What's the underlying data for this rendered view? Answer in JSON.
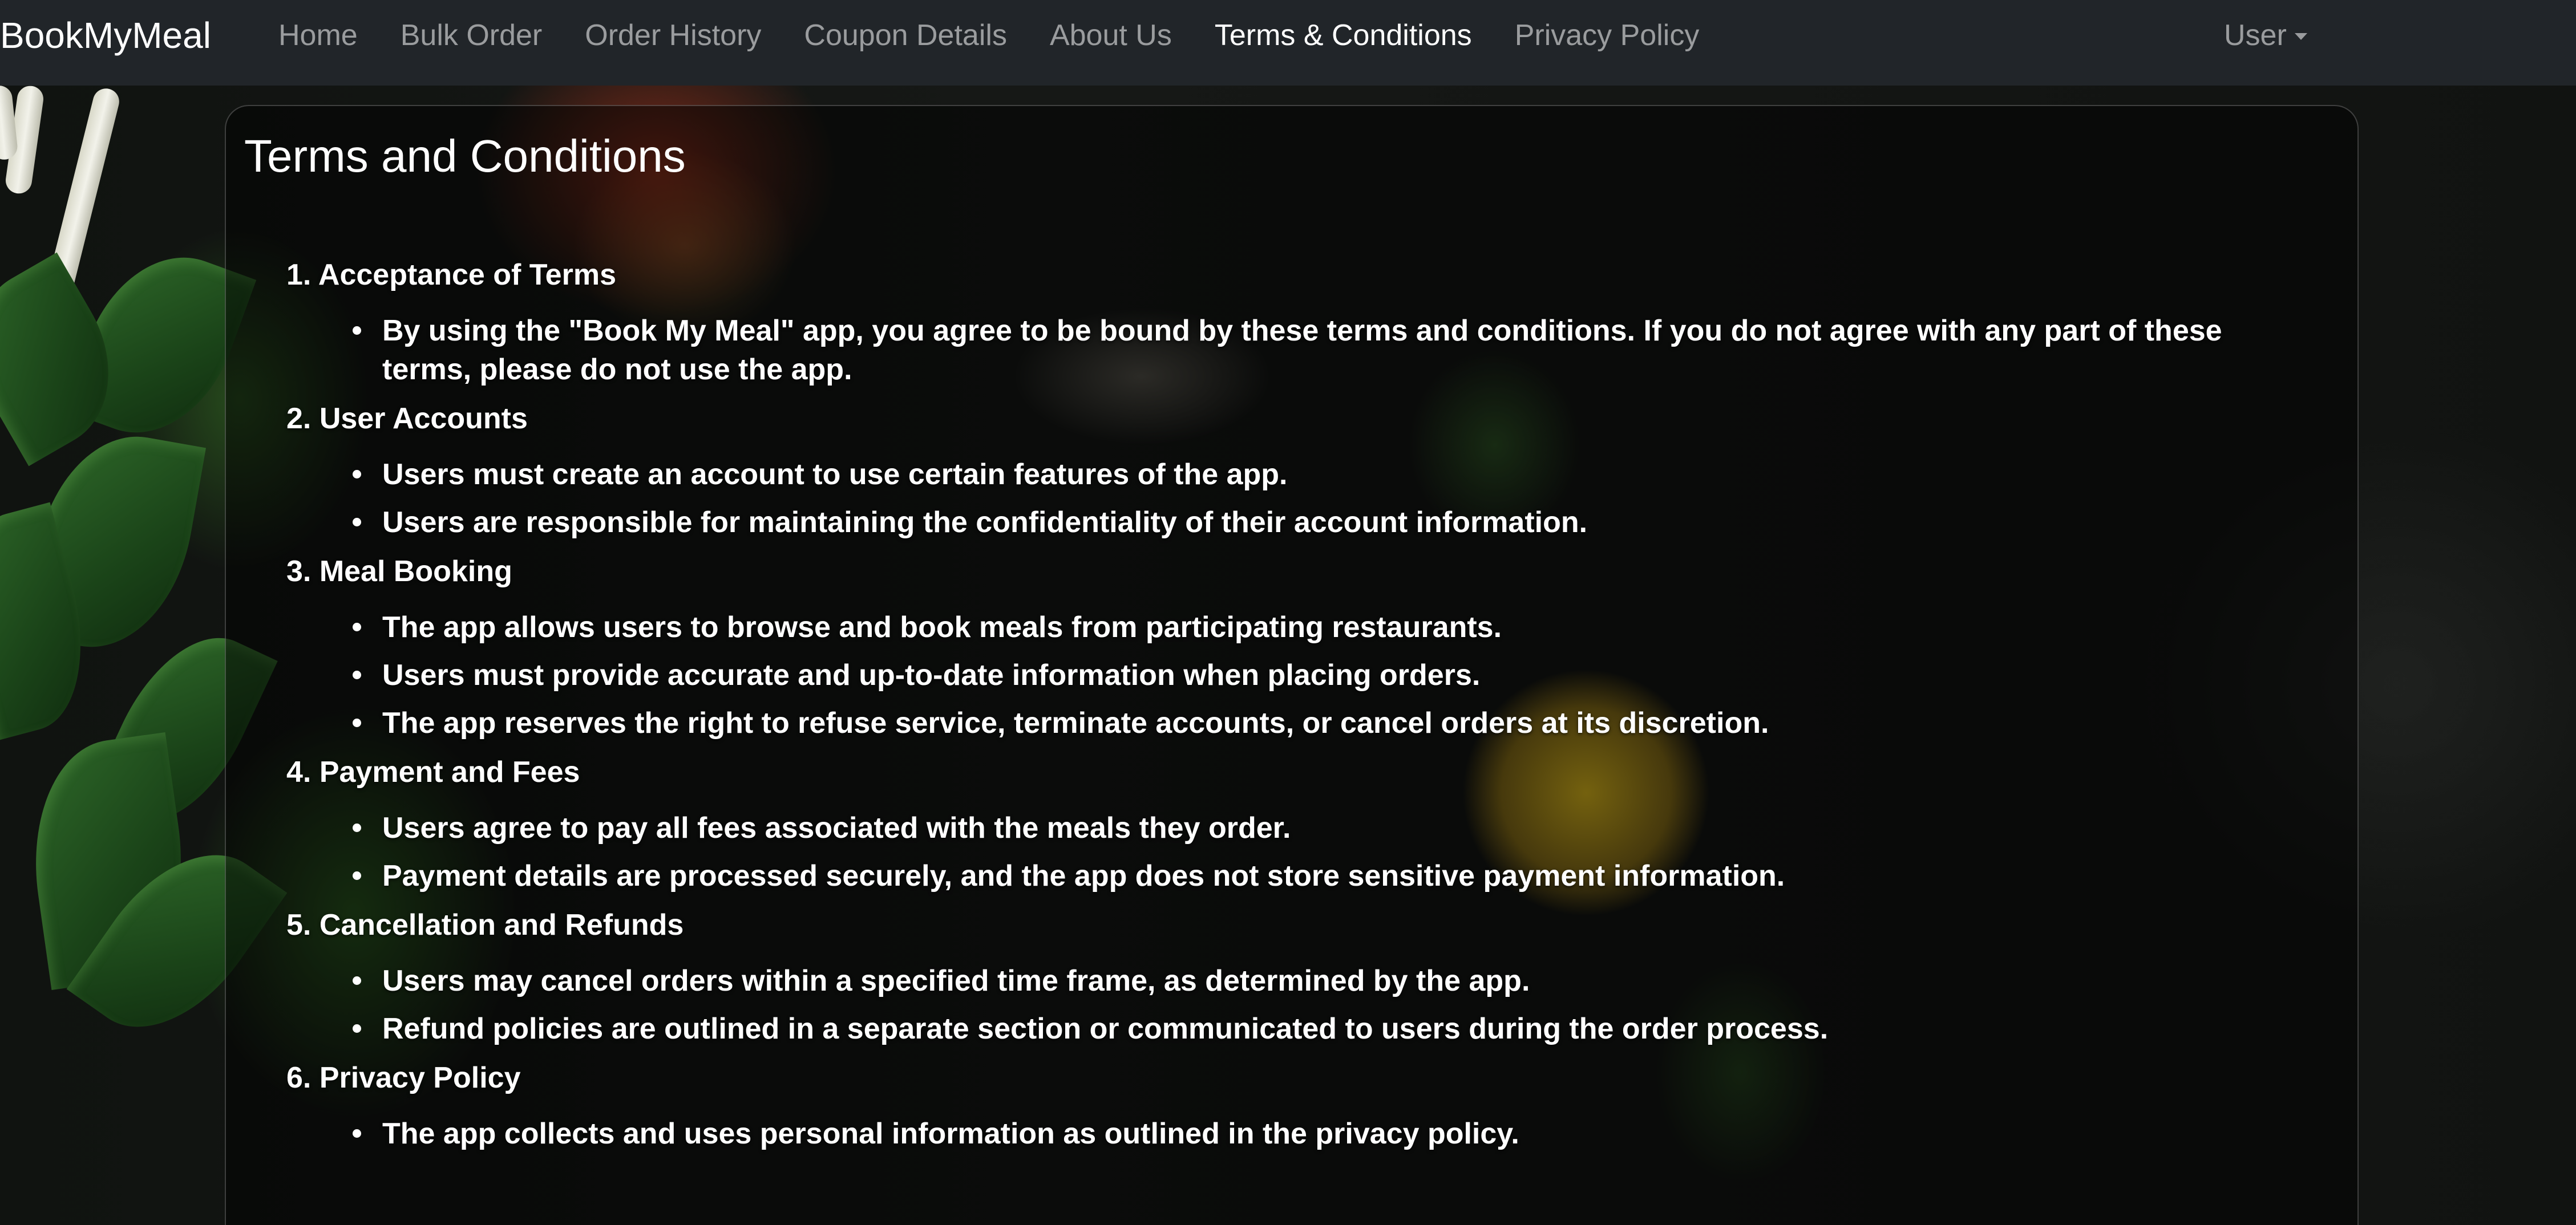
{
  "navbar": {
    "brand": "BookMyMeal",
    "links": [
      {
        "label": "Home",
        "active": false
      },
      {
        "label": "Bulk Order",
        "active": false
      },
      {
        "label": "Order History",
        "active": false
      },
      {
        "label": "Coupon Details",
        "active": false
      },
      {
        "label": "About Us",
        "active": false
      },
      {
        "label": "Terms & Conditions",
        "active": true
      },
      {
        "label": "Privacy Policy",
        "active": false
      }
    ],
    "user_menu_label": "User"
  },
  "page": {
    "title": "Terms and Conditions",
    "sections": [
      {
        "heading": "1. Acceptance of Terms",
        "items": [
          "By using the \"Book My Meal\" app, you agree to be bound by these terms and conditions. If you do not agree with any part of these terms, please do not use the app."
        ]
      },
      {
        "heading": "2. User Accounts",
        "items": [
          "Users must create an account to use certain features of the app.",
          "Users are responsible for maintaining the confidentiality of their account information."
        ]
      },
      {
        "heading": "3. Meal Booking",
        "items": [
          "The app allows users to browse and book meals from participating restaurants.",
          "Users must provide accurate and up-to-date information when placing orders.",
          "The app reserves the right to refuse service, terminate accounts, or cancel orders at its discretion."
        ]
      },
      {
        "heading": "4. Payment and Fees",
        "items": [
          "Users agree to pay all fees associated with the meals they order.",
          "Payment details are processed securely, and the app does not store sensitive payment information."
        ]
      },
      {
        "heading": "5. Cancellation and Refunds",
        "items": [
          "Users may cancel orders within a specified time frame, as determined by the app.",
          "Refund policies are outlined in a separate section or communicated to users during the order process."
        ]
      },
      {
        "heading": "6. Privacy Policy",
        "items": [
          "The app collects and uses personal information as outlined in the privacy policy."
        ]
      }
    ]
  },
  "colors": {
    "navbar_bg": "#212529",
    "nav_link": "rgba(255,255,255,0.55)",
    "nav_link_active": "#ffffff",
    "card_bg": "rgba(0,0,0,0.5)",
    "text": "#ffffff"
  },
  "icons": {
    "user_menu_caret": "caret-down-icon"
  }
}
